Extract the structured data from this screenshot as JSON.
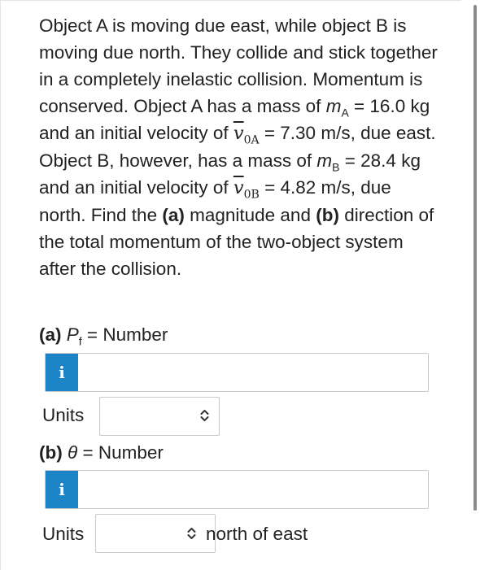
{
  "problem": {
    "part1": "Object A is moving due east, while object B is moving due north. They collide and stick together in a completely inelastic collision. Momentum is conserved. Object A has a mass of ",
    "mA_sym": "m",
    "mA_sub": "A",
    "part2": " = 16.0 kg and an initial velocity of ",
    "v0A_sym": "v",
    "v0A_sub": "0A",
    "part3": " = 7.30 m/s, due east. Object B, however, has a mass of ",
    "mB_sym": "m",
    "mB_sub": "B",
    "part4": " = 28.4 kg and an initial velocity of ",
    "v0B_sym": "v",
    "v0B_sub": "0B",
    "part5": " = 4.82 m/s, due north. Find the ",
    "a_tag": "(a)",
    "part6": " magnitude and ",
    "b_tag": "(b)",
    "part7": " direction of the total momentum of the two-object system after the collision."
  },
  "part_a": {
    "tag": "(a)",
    "symbol": "P",
    "sub": "f",
    "label": " = Number",
    "info_icon": "i",
    "units_label": "Units",
    "units_value": ""
  },
  "part_b": {
    "tag": "(b)",
    "symbol": "θ",
    "label": " = Number",
    "info_icon": "i",
    "units_label": "Units",
    "units_value": "",
    "suffix": "north of east"
  },
  "icons": {
    "info": "info-icon",
    "select": "chevron-updown-icon"
  },
  "colors": {
    "info_button": "#1a84c7"
  }
}
